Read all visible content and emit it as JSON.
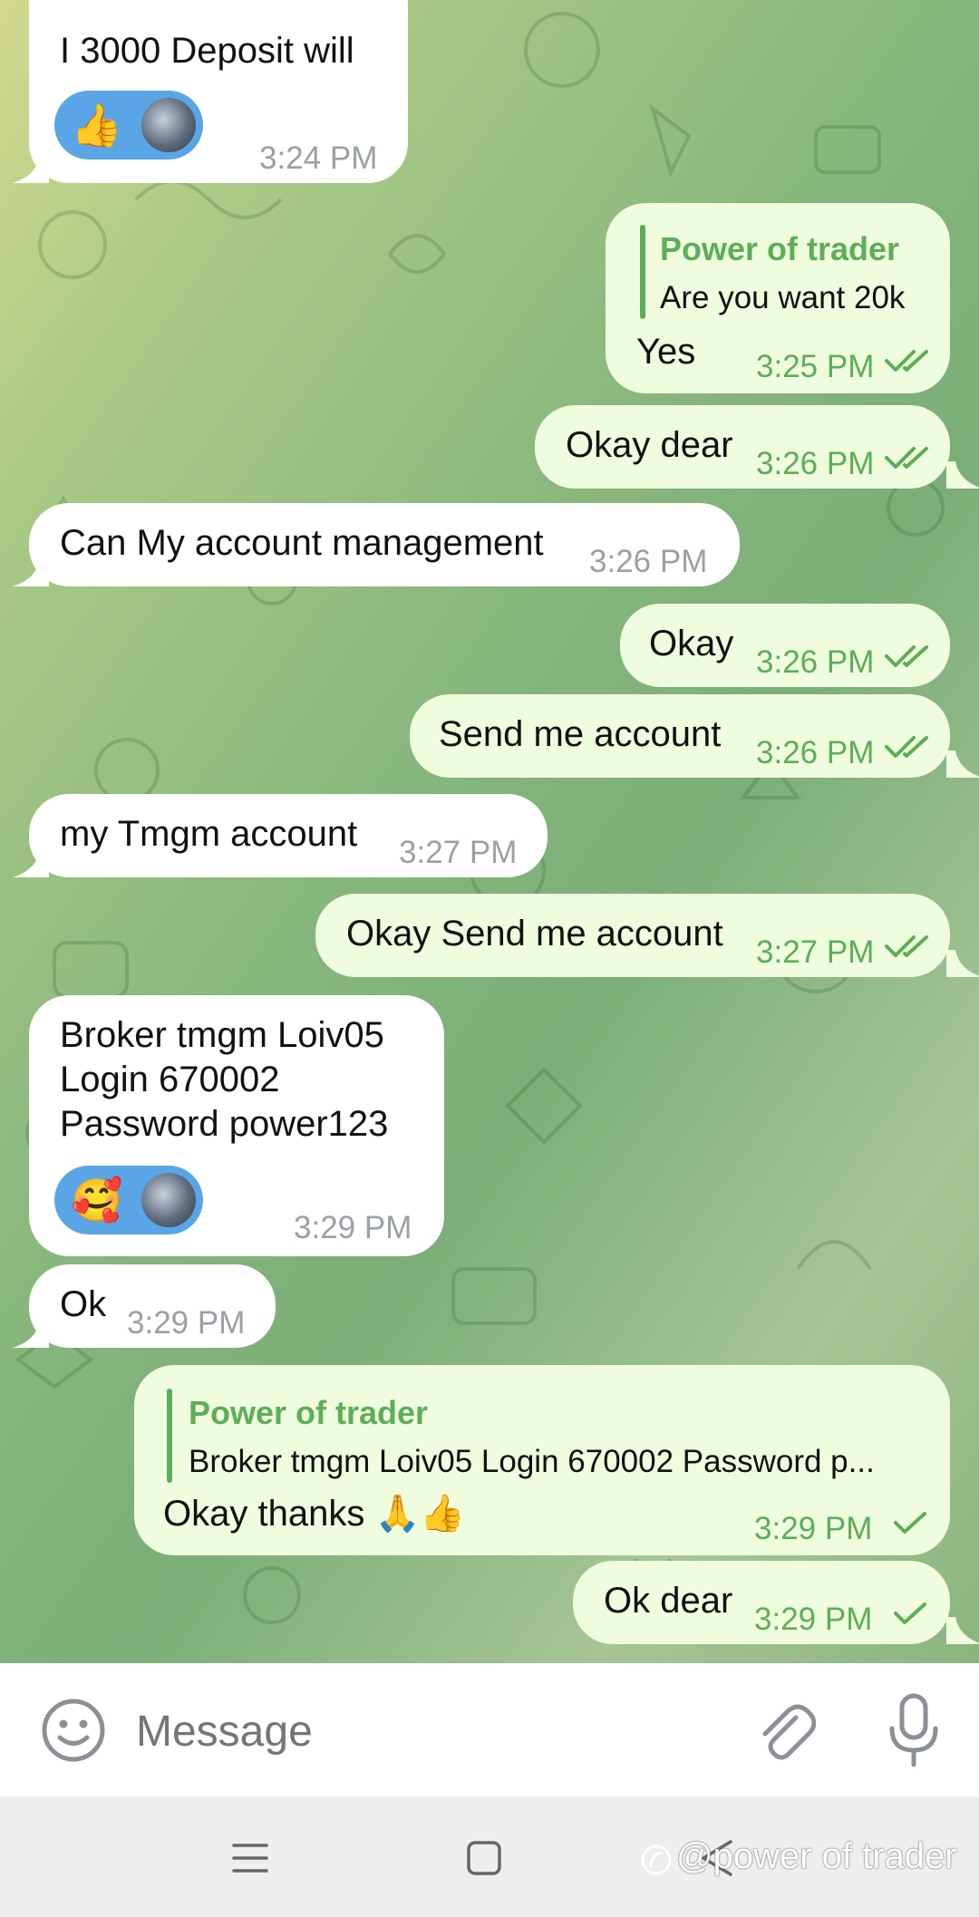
{
  "messages": [
    {
      "direction": "in",
      "text": "I 3000  Deposit will",
      "time": "3:24 PM",
      "reaction": "👍"
    },
    {
      "direction": "out",
      "reply_to": {
        "name": "Power of trader",
        "text": "Are you want 20k"
      },
      "text": "Yes",
      "time": "3:25 PM",
      "status": "read"
    },
    {
      "direction": "out",
      "text": "Okay dear",
      "time": "3:26 PM",
      "status": "read"
    },
    {
      "direction": "in",
      "text": "Can My account management",
      "time": "3:26 PM"
    },
    {
      "direction": "out",
      "text": "Okay",
      "time": "3:26 PM",
      "status": "read"
    },
    {
      "direction": "out",
      "text": "Send me account",
      "time": "3:26 PM",
      "status": "read"
    },
    {
      "direction": "in",
      "text": "my Tmgm account",
      "time": "3:27 PM"
    },
    {
      "direction": "out",
      "text": "Okay Send me account",
      "time": "3:27 PM",
      "status": "read"
    },
    {
      "direction": "in",
      "lines": [
        "Broker tmgm Loiv05",
        "Login 670002",
        "Password power123"
      ],
      "time": "3:29 PM",
      "reaction": "🥰"
    },
    {
      "direction": "in",
      "text": "Ok",
      "time": "3:29 PM"
    },
    {
      "direction": "out",
      "reply_to": {
        "name": "Power of trader",
        "text": "Broker tmgm Loiv05 Login 670002 Password p..."
      },
      "text": "Okay thanks 🙏👍",
      "time": "3:29 PM",
      "status": "sent"
    },
    {
      "direction": "out",
      "text": "Ok dear",
      "time": "3:29 PM",
      "status": "sent"
    }
  ],
  "composer": {
    "placeholder": "Message",
    "emoji_icon": "emoji-icon",
    "attach_icon": "paperclip-icon",
    "mic_icon": "microphone-icon"
  },
  "system_nav": {
    "recents_icon": "recents-icon",
    "home_icon": "home-icon",
    "back_icon": "back-icon"
  },
  "watermark": "@power of trader",
  "colors": {
    "outgoing_bubble": "#effdde",
    "incoming_bubble": "#ffffff",
    "accent": "#5cae57"
  }
}
